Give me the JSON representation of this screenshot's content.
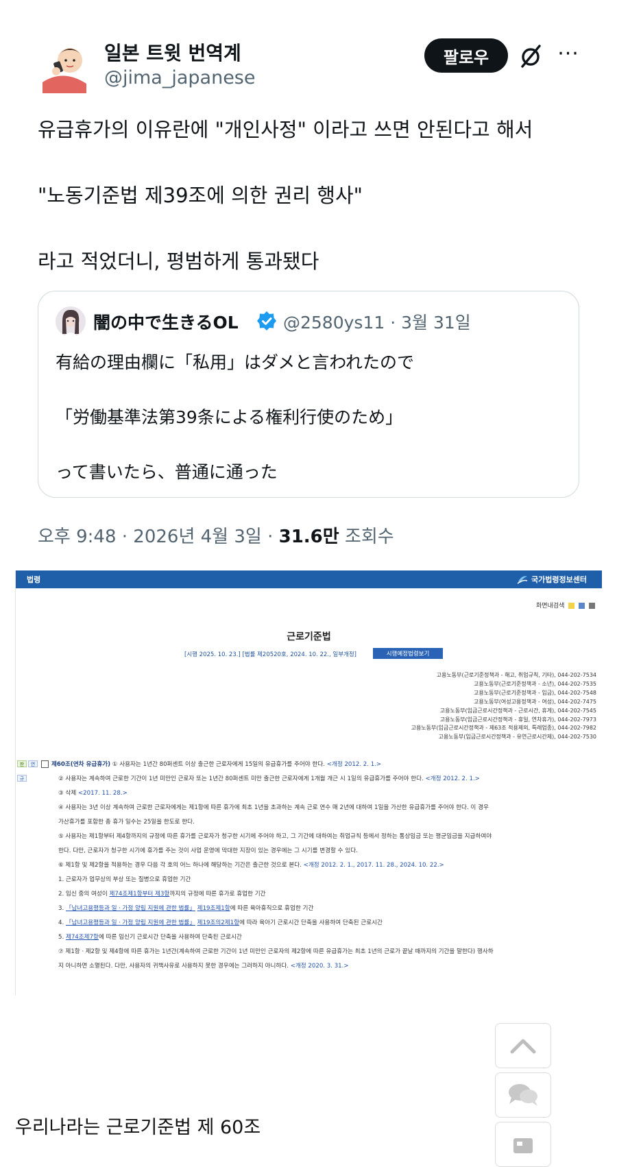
{
  "author": {
    "display_name": "일본 트윗 번역계",
    "handle": "@jima_japanese",
    "follow_label": "팔로우"
  },
  "tweet_lines": [
    "유급휴가의 이유란에 \"개인사정\" 이라고 쓰면 안된다고 해서",
    "\"노동기준법 제39조에 의한 권리 행사\"",
    "라고 적었더니, 평범하게 통과됐다"
  ],
  "quoted": {
    "name": "闇の中で生きるOL",
    "meta": "@2580ys11 · 3월 31일",
    "lines": [
      "有給の理由欄に「私用」はダメと言われたので",
      "「労働基準法第39条による権利行使のため」",
      "って書いたら、普通に通った"
    ]
  },
  "timestamp": {
    "time": "오후 9:48 · 2026년 4월 3일 · ",
    "views_count": "31.6만",
    "views_label": " 조회수"
  },
  "law_page": {
    "topbar_label": "법령",
    "org_logo": "국가법령정보센터",
    "tools": "화면내검색",
    "title": "근로기준법",
    "enactment": "[시행 2025. 10. 23.] [법률 제20520호, 2024. 10. 22., 일부개정]",
    "upcoming_button": "시행예정법령보기",
    "contacts": [
      "고용노동부(근로기준정책과 - 해고, 취업규칙, 기타), 044-202-7534",
      "고용노동부(근로기준정책과 - 소년), 044-202-7535",
      "고용노동부(근로기준정책과 - 임금), 044-202-7548",
      "고용노동부(여성고용정책과 - 여성), 044-202-7475",
      "고용노동부(임금근로시간정책과 - 근로시간, 휴게), 044-202-7545",
      "고용노동부(임금근로시간정책과 - 휴일, 연차휴가), 044-202-7973",
      "고용노동부(임금근로시간정책과 - 제63조 적용제외, 특례업종), 044-202-7982",
      "고용노동부(임금근로시간정책과 - 유연근로시간제), 044-202-7530"
    ],
    "side_tags": [
      "판",
      "연",
      "규"
    ],
    "article_heading": "제60조(연차 유급휴가)",
    "lines": [
      {
        "text": " ① 사용자는 1년간 80퍼센트 이상 출근한 근로자에게 15일의 유급휴가를 주어야 한다. ",
        "rev": "<개정 2012. 2. 1.>"
      },
      {
        "text": "② 사용자는 계속하여 근로한 기간이 1년 미만인 근로자 또는 1년간 80퍼센트 미만 출근한 근로자에게 1개월 개근 시 1일의 유급휴가를 주어야 한다. ",
        "rev": "<개정 2012. 2. 1.>"
      },
      {
        "text": "③ 삭제 ",
        "rev": "<2017. 11. 28.>"
      },
      {
        "text": "④ 사용자는 3년 이상 계속하여 근로한 근로자에게는 제1항에 따른 휴가에 최초 1년을 초과하는 계속 근로 연수 매 2년에 대하여 1일을 가산한 유급휴가를 주어야 한다. 이 경우",
        "rev": ""
      },
      {
        "text": "가산휴가를 포함한 총 휴가 일수는 25일을 한도로 한다.",
        "rev": ""
      },
      {
        "text": "⑤ 사용자는 제1항부터 제4항까지의 규정에 따른 휴가를 근로자가 청구한 시기에 주어야 하고, 그 기간에 대하여는 취업규칙 등에서 정하는 통상임금 또는 평균임금을 지급하여야",
        "rev": ""
      },
      {
        "text": "한다. 다만, 근로자가 청구한 시기에 휴가를 주는 것이 사업 운영에 막대한 지장이 있는 경우에는 그 시기를 변경할 수 있다.",
        "rev": ""
      },
      {
        "text": "⑥ 제1항 및 제2항을 적용하는 경우 다음 각 호의 어느 하나에 해당하는 기간은 출근한 것으로 본다. ",
        "rev": "<개정 2012. 2. 1., 2017. 11. 28., 2024. 10. 22.>"
      },
      {
        "text": "1. 근로자가 업무상의 부상 또는 질병으로 휴업한 기간",
        "rev": ""
      },
      {
        "pre": "2. 임신 중의 여성이 ",
        "link": "제74조제1항부터 제3항",
        "text": "까지의 규정에 따른 휴가로 휴업한 기간",
        "rev": ""
      },
      {
        "pre": "3. ",
        "link": "「남녀고용평등과 일ㆍ가정 양립 지원에 관한 법률」",
        "link2": "제19조제1항",
        "text": "에 따른 육아휴직으로 휴업한 기간",
        "rev": ""
      },
      {
        "pre": "4. ",
        "link": "「남녀고용평등과 일ㆍ가정 양립 지원에 관한 법률」",
        "link2": "제19조의2제1항",
        "text": "에 따라 육아기 근로시간 단축을 사용하여 단축된 근로시간",
        "rev": ""
      },
      {
        "pre": "5. ",
        "link": "제74조제7항",
        "text": "에 따른 임신기 근로시간 단축을 사용하여 단축된 근로시간",
        "rev": ""
      },
      {
        "text": "⑦ 제1항ㆍ제2항 및 제4항에 따른 휴가는 1년간(계속하여 근로한 기간이 1년 미만인 근로자의 제2항에 따른 유급휴가는 최초 1년의 근로가 끝날 때까지의 기간을 말한다) 행사하",
        "rev": ""
      },
      {
        "text": "지 아니하면 소멸된다. 다만, 사용자의 귀책사유로 사용하지 못한 경우에는 그러하지 아니하다. ",
        "rev": "<개정 2020. 3. 31.>"
      }
    ]
  },
  "caption": "우리나라는 근로기준법 제 60조"
}
